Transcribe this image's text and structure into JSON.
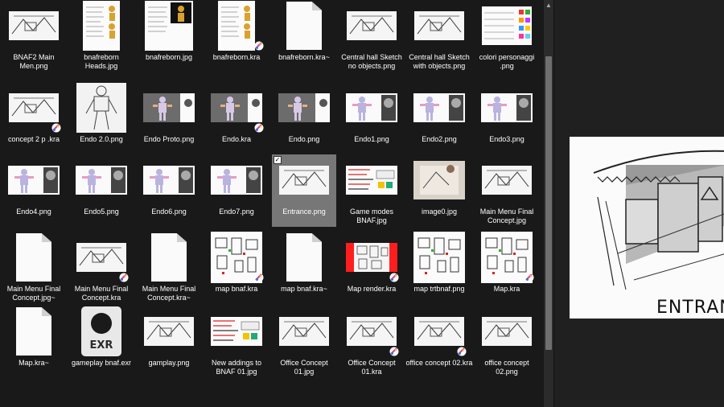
{
  "items": [
    {
      "name": "BNAF2 Main Men.png",
      "kind": "sketch"
    },
    {
      "name": "bnafreborn Heads.jpg",
      "kind": "doc-gold"
    },
    {
      "name": "bnafreborn.jpg",
      "kind": "doc-dark"
    },
    {
      "name": "bnafreborn.kra",
      "kind": "doc-gold",
      "badge": true
    },
    {
      "name": "bnafreborn.kra~",
      "kind": "blank"
    },
    {
      "name": "Central hall Sketch no objects.png",
      "kind": "sketch"
    },
    {
      "name": "Central hall Sketch with objects.png",
      "kind": "sketch"
    },
    {
      "name": "colori personaggi .png",
      "kind": "colors"
    },
    {
      "name": "concept 2 p        .kra",
      "kind": "sketch",
      "badge": true
    },
    {
      "name": "Endo 2.0.png",
      "kind": "endo-big"
    },
    {
      "name": "Endo Proto.png",
      "kind": "endo-gray"
    },
    {
      "name": "Endo.kra",
      "kind": "endo-gray",
      "badge": true
    },
    {
      "name": "Endo.png",
      "kind": "endo-gray"
    },
    {
      "name": "Endo1.png",
      "kind": "endo-white"
    },
    {
      "name": "Endo2.png",
      "kind": "endo-white"
    },
    {
      "name": "Endo3.png",
      "kind": "endo-white"
    },
    {
      "name": "Endo4.png",
      "kind": "endo-white"
    },
    {
      "name": "Endo5.png",
      "kind": "endo-white"
    },
    {
      "name": "Endo6.png",
      "kind": "endo-white"
    },
    {
      "name": "Endo7.png",
      "kind": "endo-white"
    },
    {
      "name": "Entrance.png",
      "kind": "sketch",
      "selected": true
    },
    {
      "name": "Game modes BNAF.jpg",
      "kind": "notes-red"
    },
    {
      "name": "image0.jpg",
      "kind": "photo"
    },
    {
      "name": "Main Menu Final Concept.jpg",
      "kind": "sketch"
    },
    {
      "name": "Main Menu Final Concept.jpg~",
      "kind": "blank"
    },
    {
      "name": "Main Menu Final Concept.kra",
      "kind": "sketch",
      "badge": true
    },
    {
      "name": "Main Menu Final Concept.kra~",
      "kind": "blank"
    },
    {
      "name": "map bnaf.kra",
      "kind": "map",
      "badge": true
    },
    {
      "name": "map bnaf.kra~",
      "kind": "blank"
    },
    {
      "name": "Map render.kra",
      "kind": "map-red",
      "badge": true
    },
    {
      "name": "map trtbnaf.png",
      "kind": "map"
    },
    {
      "name": "Map.kra",
      "kind": "map",
      "badge": true
    },
    {
      "name": "Map.kra~",
      "kind": "blank"
    },
    {
      "name": "gameplay bnaf.exr",
      "kind": "exr"
    },
    {
      "name": "gamplay.png",
      "kind": "sketch"
    },
    {
      "name": "New addings to BNAF 01.jpg",
      "kind": "notes-red"
    },
    {
      "name": "Office Concept 01.jpg",
      "kind": "sketch"
    },
    {
      "name": "Office Concept 01.kra",
      "kind": "sketch",
      "badge": true
    },
    {
      "name": "office concept 02.kra",
      "kind": "sketch",
      "badge": true
    },
    {
      "name": "office concept 02.png",
      "kind": "sketch"
    }
  ],
  "exr_ext": "EXR",
  "selected_check": "✓",
  "preview": {
    "caption": "ENTRAN"
  },
  "colors": {
    "bg": "#191919",
    "selected": "#777777",
    "scroll_thumb": "#6f6f6f"
  }
}
